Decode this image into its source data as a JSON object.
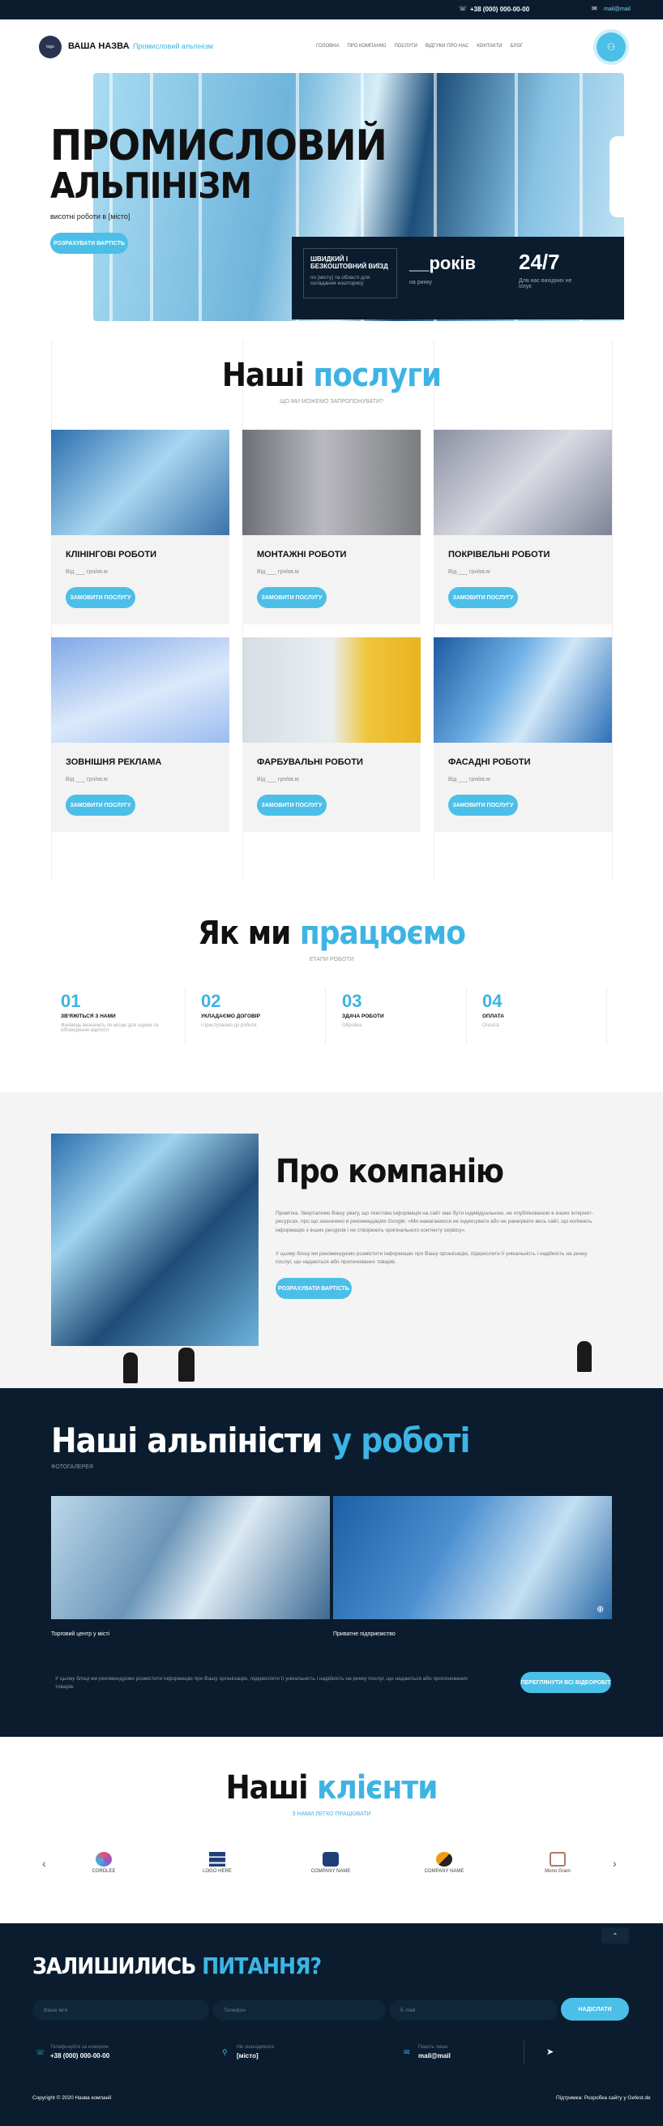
{
  "topbar": {
    "phone": "+38 (000) 000-00-00",
    "email": "mail@mail"
  },
  "header": {
    "logo_text": "logo",
    "brand": "ВАША НАЗВА",
    "tagline": "Промисловий альпінізм",
    "nav": [
      "ГОЛОВНА",
      "ПРО КОМПАНІЮ",
      "ПОСЛУГИ",
      "ВІДГУКИ ПРО НАС",
      "КОНТАКТИ",
      "БЛОГ"
    ]
  },
  "hero": {
    "title_line1": "ПРОМИСЛОВИЙ",
    "title_line2": "АЛЬПІНІЗМ",
    "subtitle": "висотні роботи в [місто]",
    "cta": "РОЗРАХУВАТИ ВАРТІСТЬ",
    "feature_title": "ШВИДКИЙ І БЕЗКОШТОВНИЙ ВИЇЗД",
    "feature_text": "по [місту] та області для складання кошторису",
    "years_value": "__років",
    "years_text": "на ринку",
    "hours_value": "24/7",
    "hours_text": "Для нас вихідних не існує"
  },
  "services": {
    "title_plain": "Наші",
    "title_accent": "послуги",
    "subtitle": "ЩО МИ МОЖЕМО ЗАПРОПОНУВАТИ?",
    "order_label": "ЗАМОВИТИ ПОСЛУГУ",
    "items": [
      {
        "name": "КЛІНІНГОВІ РОБОТИ",
        "price": "Від ___ грн/кв.м"
      },
      {
        "name": "МОНТАЖНІ РОБОТИ",
        "price": "Від ___ грн/кв.м"
      },
      {
        "name": "ПОКРІВЕЛЬНІ РОБОТИ",
        "price": "Від ___ грн/кв.м"
      },
      {
        "name": "ЗОВНІШНЯ РЕКЛАМА",
        "price": "Від ___ грн/кв.м"
      },
      {
        "name": "ФАРБУВАЛЬНІ РОБОТИ",
        "price": "Від ___ грн/кв.м"
      },
      {
        "name": "ФАСАДНІ РОБОТИ",
        "price": "Від ___ грн/кв.м"
      }
    ]
  },
  "process": {
    "title_plain": "Як ми",
    "title_accent": "працюємо",
    "subtitle": "ЕТАПИ РОБОТИ",
    "steps": [
      {
        "num": "01",
        "title": "ЗВ'ЯЖІТЬСЯ З НАМИ",
        "desc": "Фахівець визначить по місцю для оцінки та обговорення вартості"
      },
      {
        "num": "02",
        "title": "УКЛАДАЄМО ДОГОВІР",
        "desc": "і приступаємо до роботи"
      },
      {
        "num": "03",
        "title": "ЗДАЧА РОБОТИ",
        "desc": "Обробка"
      },
      {
        "num": "04",
        "title": "ОПЛАТА",
        "desc": "Оплата"
      }
    ]
  },
  "about": {
    "title": "Про компанію",
    "p1": "Примітка. Зверталемо Вашу увагу, що текстова інформація на сайт має бути індивідуальною, не опублікованою в інших інтернет-ресурсах, про що зазначено в рекомендаціях Google: «Ми намагаємося не індексувати або не ранжувати весь сайт, що копіюють інформацію з інших ресурсів і не створюють оригінального контенту сервісу».",
    "p2": "У цьому блоці ми рекомендуємо розмістити інформацію про Вашу організацію, підкреслити її унікальність і надійність на ринку послуг, що надаються або пропонованих товарів.",
    "cta": "РОЗРАХУВАТИ ВАРТІСТЬ"
  },
  "gallery": {
    "title_plain": "Наші альпіністи",
    "title_accent": "у роботі",
    "subtitle": "ФОТОГАЛЕРЕЯ",
    "captions": [
      "Торговий центр у місті",
      "Приватне підприємство"
    ],
    "text": "У цьому блоці ми рекомендуємо розмістити інформацію про Вашу організацію, підкреслити її унікальність і надійність на ринку послуг, що надаються або пропонованих товарів.",
    "cta": "ПЕРЕГЛЯНУТИ ВСІ ВІДЕОРОБІТ"
  },
  "clients": {
    "title_plain": "Наші",
    "title_accent": "клієнти",
    "subtitle": "З НАМИ ЛЕГКО ПРАЦЮВАТИ",
    "logos": [
      "CORDLEE",
      "LOGO HERE",
      "COMPANY NAME",
      "COMPANY NAME",
      "Mono Gram"
    ]
  },
  "footer": {
    "title_plain": "ЗАЛИШИЛИСЬ",
    "title_accent": "ПИТАННЯ?",
    "name_placeholder": "Ваше ім'я",
    "phone_placeholder": "Телефон",
    "email_placeholder": "E-mail",
    "send": "НАДІСЛАТИ",
    "contacts": [
      {
        "label": "Телефонуйте за номером",
        "value": "+38 (000) 000-00-00"
      },
      {
        "label": "Ми знаходимося",
        "value": "[місто]"
      },
      {
        "label": "Пишіть лише",
        "value": "mail@mail"
      }
    ],
    "copyright": "Copyright © 2020 Назва компанії",
    "developer": "Підтримка: Розробка сайту у Gefest.de"
  }
}
